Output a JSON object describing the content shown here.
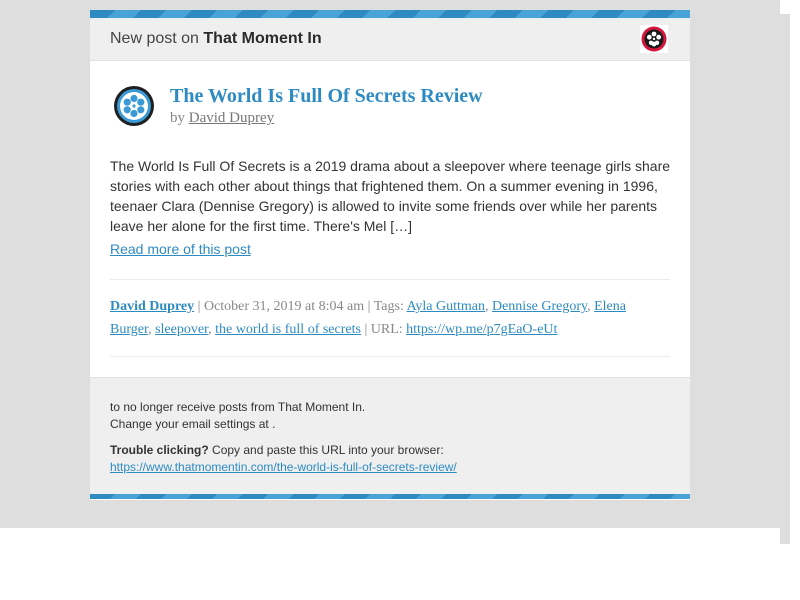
{
  "header": {
    "prefix": "New post on",
    "site_name": "That Moment In",
    "logo_icon": "film-reel-icon"
  },
  "post": {
    "avatar_icon": "film-reel-icon",
    "title": "The World Is Full Of Secrets Review",
    "by_prefix": "by",
    "author": "David Duprey",
    "excerpt": "The World Is Full Of Secrets is a 2019 drama about a sleepover where teenage girls share stories with each other about things that frightened them. On a summer evening in 1996, teenaer Clara (Dennise Gregory) is allowed to invite some friends over while her parents leave her alone for the first time. There's Mel […]",
    "read_more": "Read more of this post"
  },
  "meta": {
    "author": "David Duprey",
    "date_sep": " | ",
    "date": "October 31, 2019 at 8:04 am",
    "tags_prefix": " | Tags: ",
    "tags": [
      "Ayla Guttman",
      "Dennise Gregory",
      "Elena Burger",
      "sleepover",
      "the world is full of secrets"
    ],
    "url_prefix": " | URL: ",
    "short_url": "https://wp.me/p7gEaO-eUt"
  },
  "footer": {
    "unsubscribe": "to no longer receive posts from That Moment In.",
    "settings": "Change your email settings at .",
    "trouble_label": "Trouble clicking?",
    "trouble_text": " Copy and paste this URL into your browser:",
    "full_url": "https://www.thatmomentin.com/the-world-is-full-of-secrets-review/"
  },
  "colors": {
    "accent": "#2e8bc2",
    "logo_ring": "#d6163e",
    "avatar_blue": "#3b9ad6",
    "background": "#dedede"
  }
}
